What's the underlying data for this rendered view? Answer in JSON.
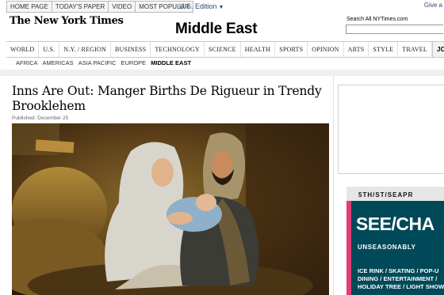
{
  "topnav": {
    "links": [
      "HOME PAGE",
      "TODAY'S PAPER",
      "VIDEO",
      "MOST POPULAR"
    ],
    "edition": "U.S. Edition",
    "give": "Give a"
  },
  "header": {
    "logo": "The New York Times",
    "section_title": "Middle East",
    "search_label": "Search All NYTimes.com"
  },
  "mainnav": {
    "items": [
      "WORLD",
      "U.S.",
      "N.Y. / REGION",
      "BUSINESS",
      "TECHNOLOGY",
      "SCIENCE",
      "HEALTH",
      "SPORTS",
      "OPINION",
      "ARTS",
      "STYLE",
      "TRAVEL",
      "JOBS"
    ]
  },
  "subnav": {
    "items": [
      "AFRICA",
      "AMERICAS",
      "ASIA PACIFIC",
      "EUROPE",
      "MIDDLE EAST"
    ]
  },
  "article": {
    "headline": "Inns Are Out: Manger Births De Rigueur in Trendy Brooklehem",
    "published": "Published: December 25"
  },
  "ad": {
    "top_text": "5TH/ST/SEAPR",
    "headline": "SEE/CHA",
    "subtitle": "UNSEASONABLY",
    "lines": [
      "ICE RINK / SKATING / POP-U",
      "DINING / ENTERTAINMENT /",
      "HOLIDAY TREE / LIGHT SHOW"
    ]
  },
  "colors": {
    "ad_background": "#004958",
    "ad_accent": "#e23c7a",
    "link": "#2a4a7a"
  }
}
